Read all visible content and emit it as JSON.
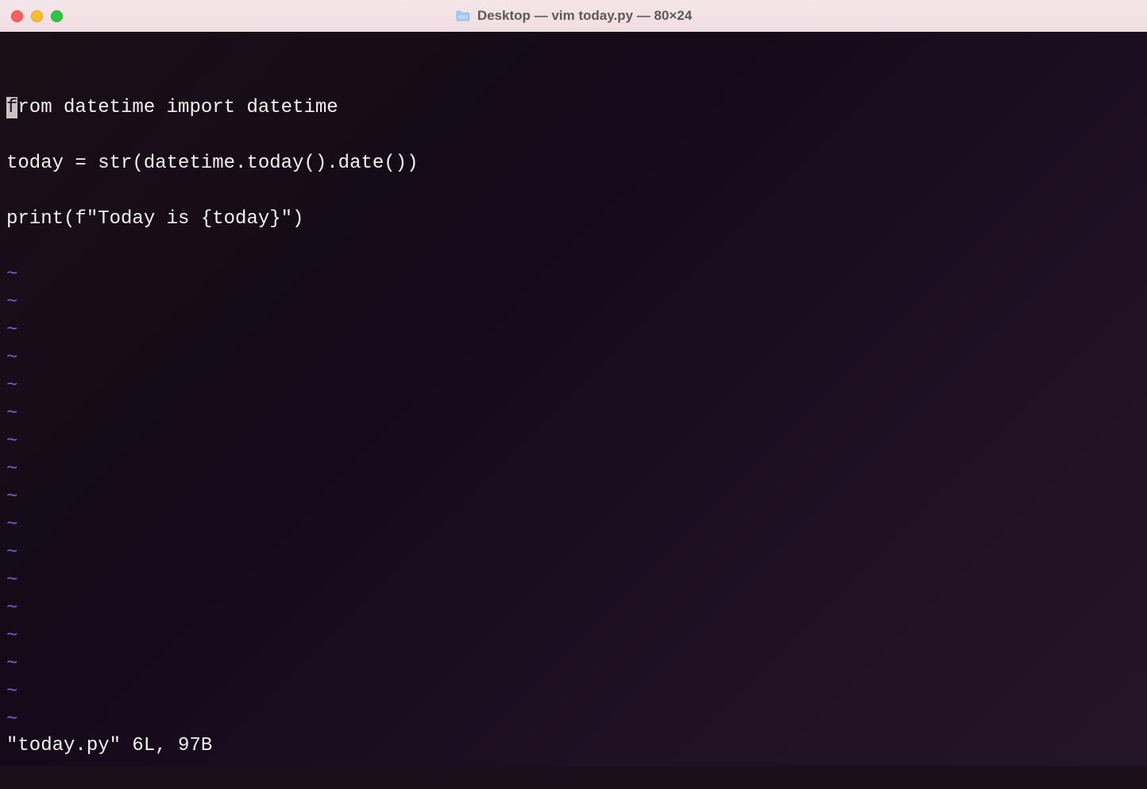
{
  "window": {
    "title": "Desktop — vim today.py — 80×24"
  },
  "editor": {
    "cursor_char": "f",
    "line1_rest": "rom datetime import datetime",
    "line2": "",
    "line3": "today = str(datetime.today().date())",
    "line4": "",
    "line5": "print(f\"Today is {today}\")",
    "tilde": "~",
    "status": "\"today.py\" 6L, 97B"
  }
}
